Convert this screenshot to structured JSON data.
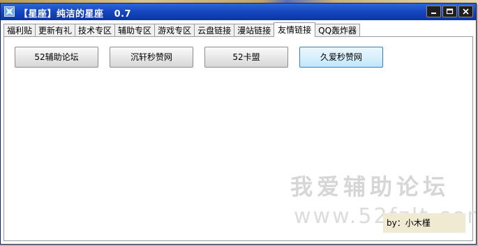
{
  "window": {
    "title": "【星座】纯洁的星座   0.7",
    "controls": {
      "minimize_icon": "minimize-icon",
      "maximize_icon": "maximize-icon",
      "close_icon": "close-icon"
    }
  },
  "tabs": [
    {
      "label": "福利贴",
      "active": false
    },
    {
      "label": "更新有礼",
      "active": false
    },
    {
      "label": "技术专区",
      "active": false
    },
    {
      "label": "辅助专区",
      "active": false
    },
    {
      "label": "游戏专区",
      "active": false
    },
    {
      "label": "云盘链接",
      "active": false
    },
    {
      "label": "漫站链接",
      "active": false
    },
    {
      "label": "友情链接",
      "active": true
    },
    {
      "label": "QQ轰炸器",
      "active": false
    }
  ],
  "panel": {
    "buttons": [
      {
        "label": "52辅助论坛",
        "hover": false
      },
      {
        "label": "沉轩秒赞网",
        "hover": false
      },
      {
        "label": "52卡盟",
        "hover": false
      },
      {
        "label": "久爱秒赞网",
        "hover": true
      }
    ],
    "by_label": "by：小木槿"
  },
  "watermark": {
    "text": "我爱辅助论坛",
    "url": "www.52fzlt.com"
  },
  "colors": {
    "titlebar": "#1848c0",
    "button_hover_border": "#3c7fb1",
    "by_label_bg": "#f0ead2"
  }
}
